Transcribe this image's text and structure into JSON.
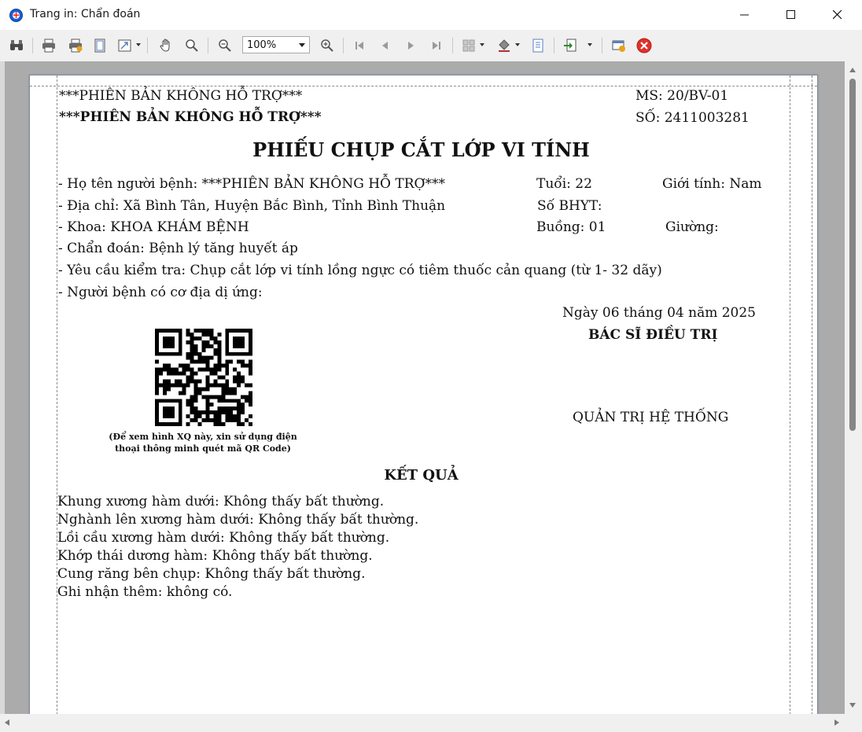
{
  "window": {
    "title": "Trang in: Chẩn đoán"
  },
  "toolbar": {
    "zoom": "100%"
  },
  "document": {
    "header_left_1": "***PHIÊN BẢN KHÔNG HỖ TRỢ***",
    "header_left_2": "***PHIÊN BẢN KHÔNG HỖ TRỢ***",
    "header_right_1": "MS: 20/BV-01",
    "header_right_2": "SỐ: 2411003281",
    "title": "PHIẾU CHỤP CẮT LỚP VI TÍNH",
    "patient_name": "- Họ tên người bệnh: ***PHIÊN BẢN KHÔNG HỖ TRỢ***",
    "age": "Tuổi: 22",
    "gender": "Giới tính: Nam",
    "address": "- Địa chỉ: Xã Bình Tân, Huyện Bắc Bình, Tỉnh Bình Thuận",
    "insurance": "Số BHYT:",
    "department": "- Khoa: KHOA KHÁM BỆNH",
    "room": "Buồng: 01",
    "bed": "Giường:",
    "diagnosis": "- Chẩn đoán: Bệnh lý tăng huyết áp",
    "request": "- Yêu cầu kiểm tra: Chụp cắt lớp vi tính lồng ngực có tiêm thuốc cản quang (từ 1- 32 dãy)",
    "allergy": "- Người bệnh có cơ địa dị ứng:",
    "date": "Ngày 06 tháng 04 năm 2025",
    "doctor_title": "BÁC SĨ ĐIỀU TRỊ",
    "doctor_name": "QUẢN TRỊ HỆ THỐNG",
    "qr_note": "(Để xem hình XQ này, xin sử dụng điện thoại thông minh quét mã QR Code)",
    "result_heading": "KẾT QUẢ",
    "results": [
      "Khung xương hàm  dưới: Không thấy bất thường.",
      "Nghành lên xương hàm dưới: Không thấy bất thường.",
      "Lồi cầu xương hàm dưới: Không thấy bất thường.",
      "Khớp thái dương hàm: Không thấy bất thường.",
      "Cung răng bên chụp: Không thấy bất thường.",
      "Ghi nhận thêm: không có."
    ]
  }
}
